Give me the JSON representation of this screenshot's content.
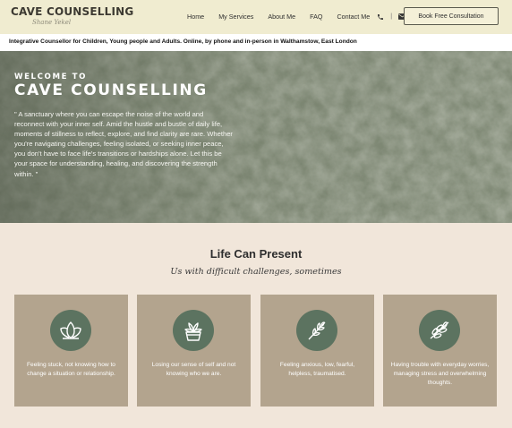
{
  "header": {
    "logo_text": "CAVE COUNSELLING",
    "logo_signature": "Shane Yekel",
    "nav": [
      {
        "label": "Home"
      },
      {
        "label": "My Services"
      },
      {
        "label": "About Me"
      },
      {
        "label": "FAQ"
      },
      {
        "label": "Contact Me"
      }
    ],
    "separator": "|",
    "phone_icon": "phone-icon",
    "mail_icon": "mail-icon",
    "cta_label": "Book Free Consultation"
  },
  "tagline": "Integrative Counsellor for Children, Young people and Adults. Online, by phone and in-person in Walthamstow, East London",
  "hero": {
    "welcome": "WELCOME TO",
    "title": "CAVE COUNSELLING",
    "quote": "\" A sanctuary where you can escape the noise of the world and reconnect with your inner self. Amid the hustle and bustle of daily life, moments of stillness to reflect, explore, and find clarity are rare. Whether you're navigating challenges, feeling isolated, or seeking inner peace, you don't have to face life's transitions or hardships alone. Let this be your space for understanding, healing, and discovering the strength within. \""
  },
  "section": {
    "title": "Life Can Present",
    "subtitle": "Us with difficult challenges, sometimes"
  },
  "cards": [
    {
      "icon": "lotus-icon",
      "text": "Feeling stuck, not knowing how to change a situation or relationship."
    },
    {
      "icon": "potted-plant-icon",
      "text": "Losing our sense of self and not knowing who we are."
    },
    {
      "icon": "leaf-branch-icon",
      "text": "Feeling anxious, low, fearful, helpless, traumatised."
    },
    {
      "icon": "olive-branch-icon",
      "text": "Having trouble with everyday worries, managing stress and overwhelming thoughts."
    }
  ],
  "colors": {
    "header_bg": "#f0ecd0",
    "hero_bg": "#7d8672",
    "page_bg": "#f1e6da",
    "card_bg": "#b3a48e",
    "badge_bg": "#5c7360"
  }
}
